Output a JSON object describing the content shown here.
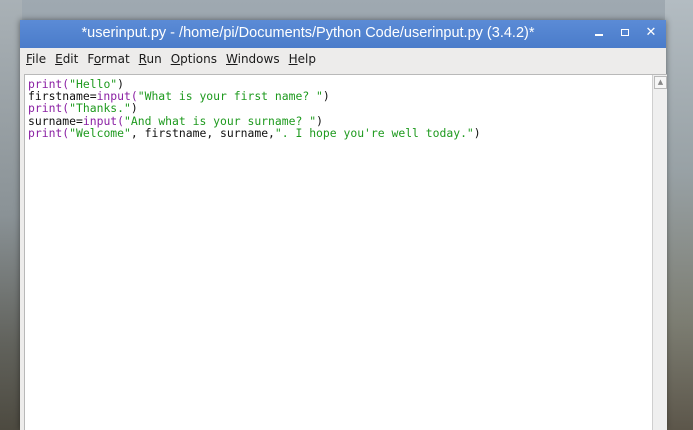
{
  "window": {
    "title": "*userinput.py - /home/pi/Documents/Python Code/userinput.py (3.4.2)*"
  },
  "menu": {
    "items": [
      {
        "accel": "F",
        "rest": "ile"
      },
      {
        "accel": "E",
        "rest": "dit"
      },
      {
        "pre": "F",
        "accel": "o",
        "rest": "rmat"
      },
      {
        "accel": "R",
        "rest": "un"
      },
      {
        "accel": "O",
        "rest": "ptions"
      },
      {
        "accel": "W",
        "rest": "indows"
      },
      {
        "accel": "H",
        "rest": "elp"
      }
    ]
  },
  "code": {
    "lines": [
      [
        {
          "t": "print(",
          "c": "kw"
        },
        {
          "t": "\"Hello\"",
          "c": "str"
        },
        {
          "t": ")",
          "c": "plain"
        }
      ],
      [
        {
          "t": "firstname=",
          "c": "plain"
        },
        {
          "t": "input(",
          "c": "kw"
        },
        {
          "t": "\"What is your first name? \"",
          "c": "str"
        },
        {
          "t": ")",
          "c": "plain"
        }
      ],
      [
        {
          "t": "print(",
          "c": "kw"
        },
        {
          "t": "\"Thanks.\"",
          "c": "str"
        },
        {
          "t": ")",
          "c": "plain"
        }
      ],
      [
        {
          "t": "surname=",
          "c": "plain"
        },
        {
          "t": "input(",
          "c": "kw"
        },
        {
          "t": "\"And what is your surname? \"",
          "c": "str"
        },
        {
          "t": ")",
          "c": "plain"
        }
      ],
      [
        {
          "t": "print(",
          "c": "kw"
        },
        {
          "t": "\"Welcome\"",
          "c": "str"
        },
        {
          "t": ", firstname, surname,",
          "c": "plain"
        },
        {
          "t": "\". I hope you're well today.\"",
          "c": "str"
        },
        {
          "t": ")",
          "c": "plain"
        }
      ]
    ]
  },
  "colors": {
    "titlebar": "#4a7cca",
    "keyword": "#8a1fa3",
    "string": "#1e9a1e"
  },
  "icons": {
    "minimize": "minimize-icon",
    "maximize": "maximize-icon",
    "close": "close-icon",
    "scroll_up": "scroll-up-arrow-icon"
  }
}
